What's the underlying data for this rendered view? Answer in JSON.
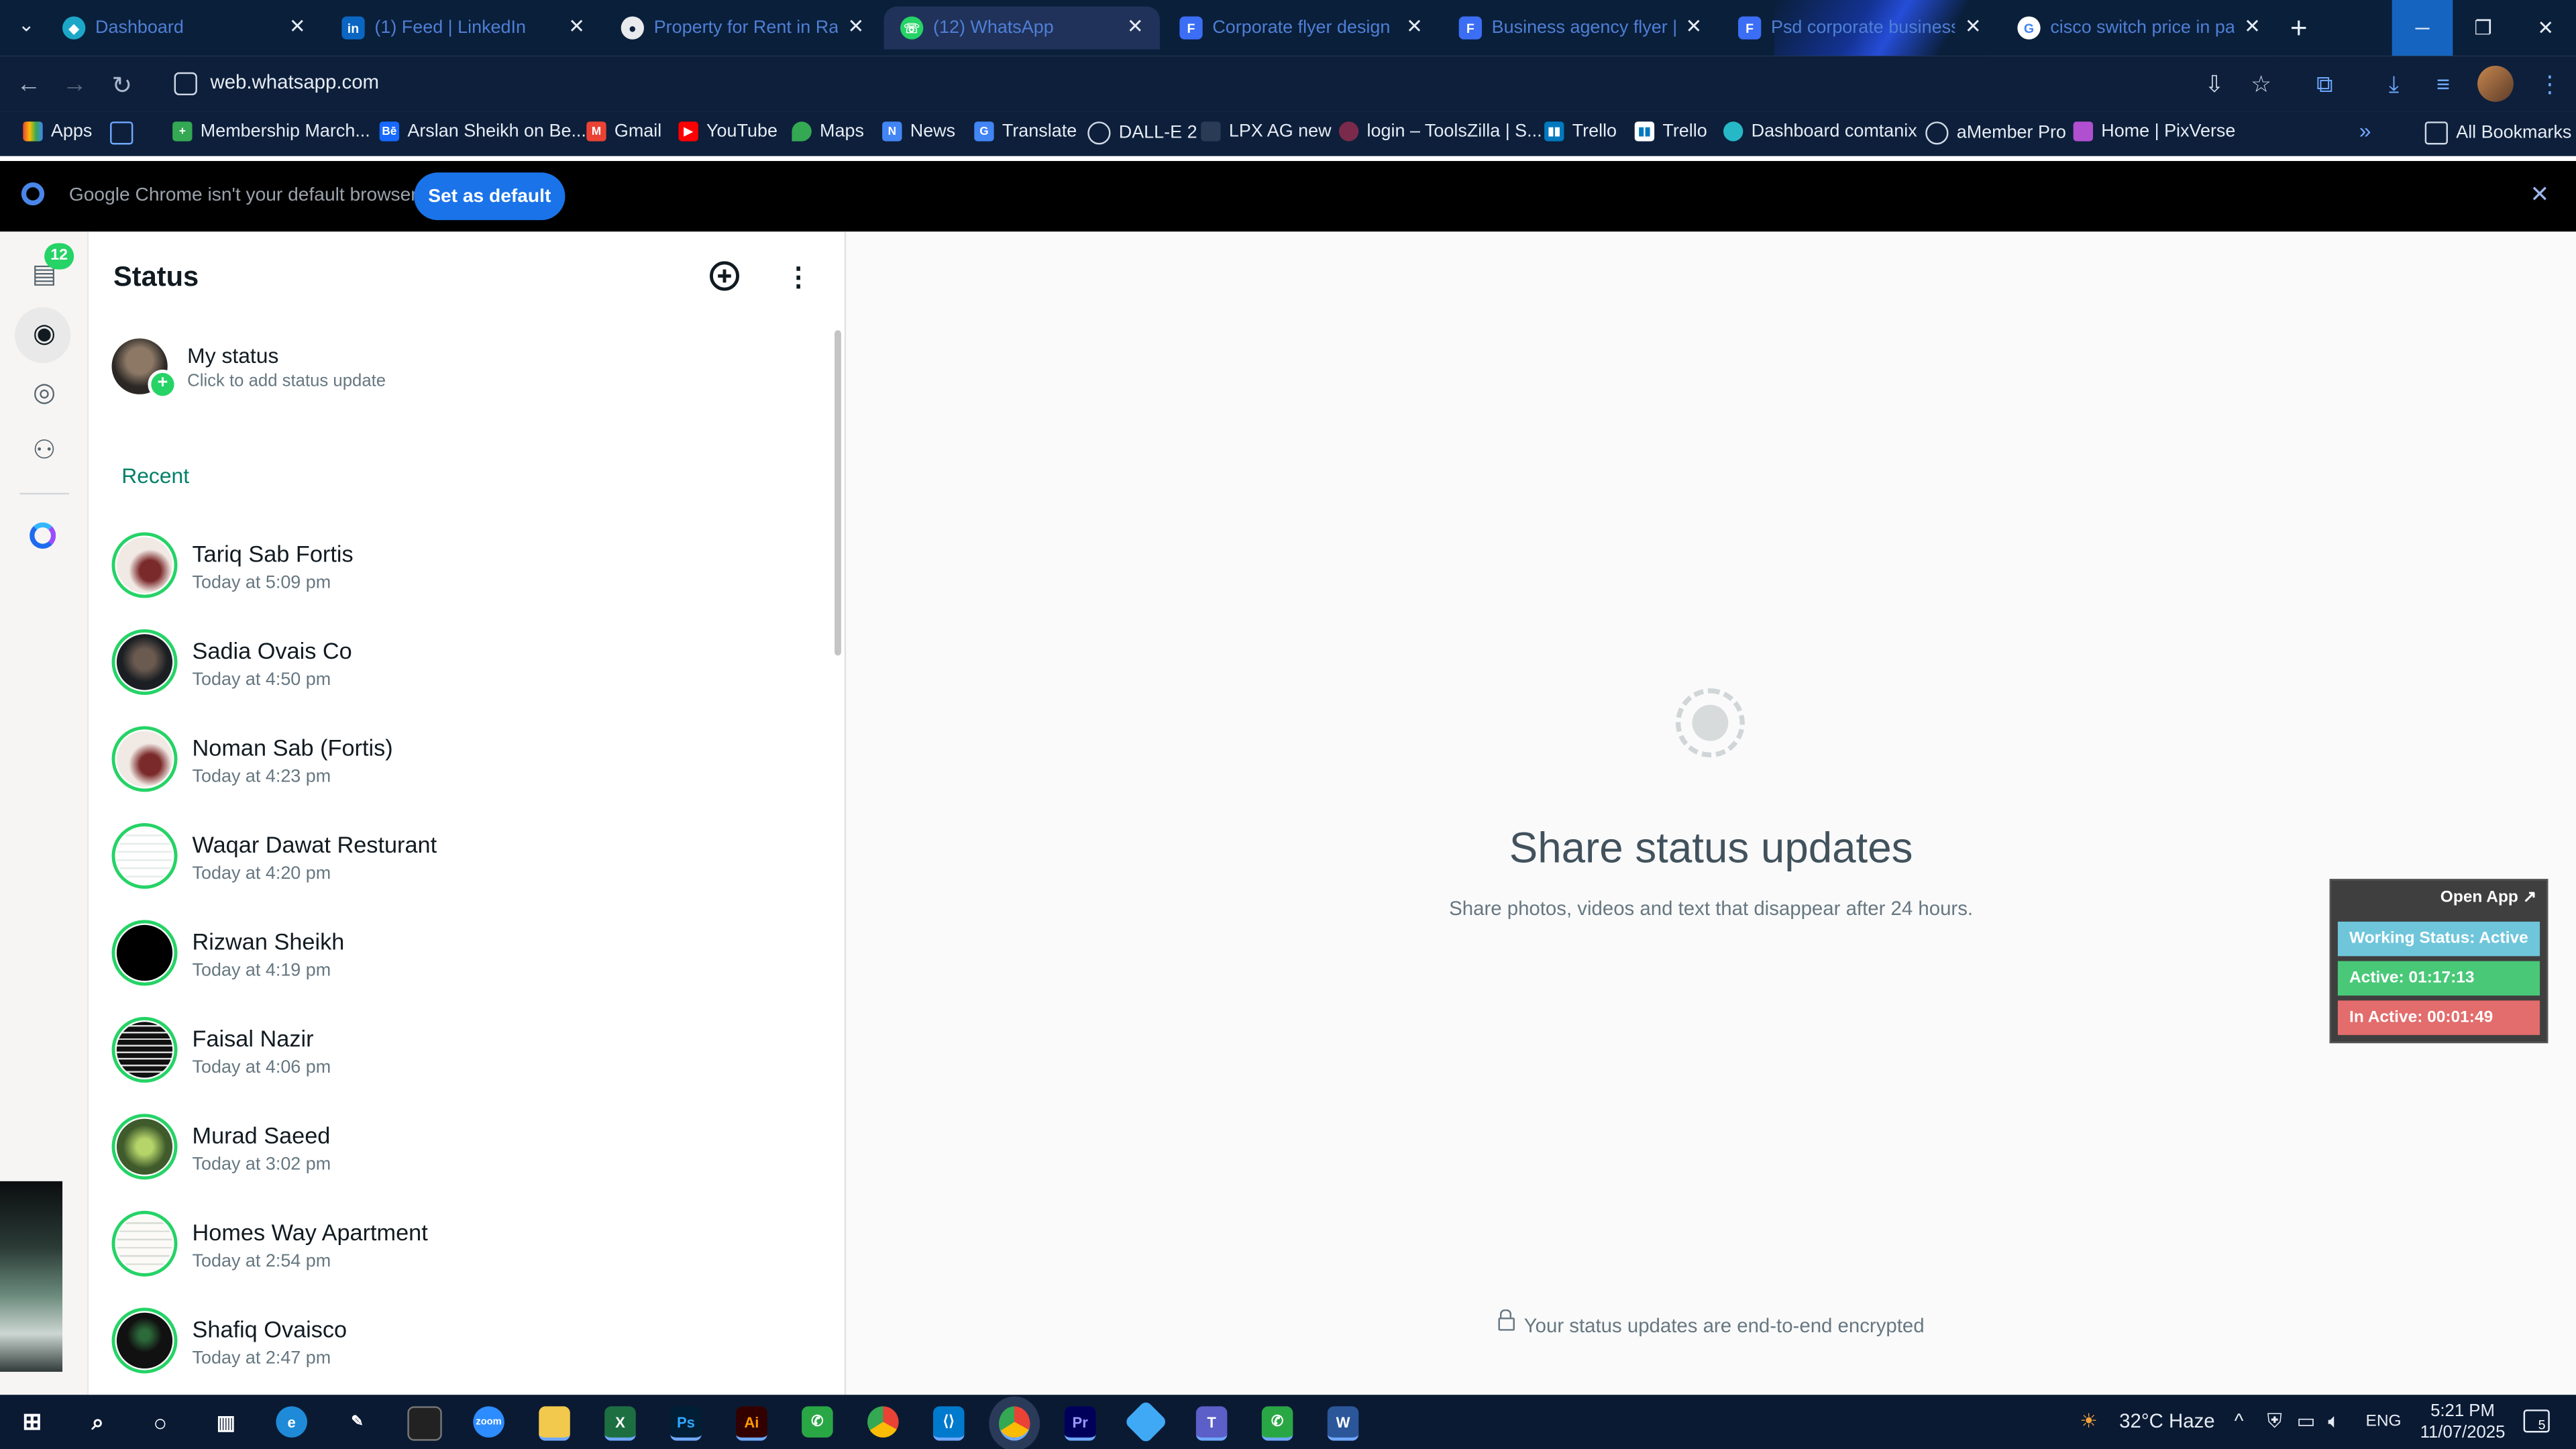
{
  "tabs": [
    {
      "label": "Dashboard",
      "icon": "dashboard-favicon",
      "color": "#1ca7c9"
    },
    {
      "label": "(1) Feed | LinkedIn",
      "icon": "linkedin-favicon",
      "color": "#0a66c2"
    },
    {
      "label": "Property for Rent in Rawal",
      "icon": "property-favicon",
      "color": "#e8eaed"
    },
    {
      "label": "(12) WhatsApp",
      "icon": "whatsapp-favicon",
      "color": "#25d366"
    },
    {
      "label": "Corporate flyer design | P",
      "icon": "freepik-favicon",
      "color": "#3b6ef5"
    },
    {
      "label": "Business agency flyer | Pr",
      "icon": "freepik-favicon",
      "color": "#3b6ef5"
    },
    {
      "label": "Psd corporate business fl",
      "icon": "freepik-favicon",
      "color": "#3b6ef5"
    },
    {
      "label": "cisco switch price in paki",
      "icon": "google-favicon",
      "color": "#ffffff"
    }
  ],
  "address": {
    "url": "web.whatsapp.com"
  },
  "bookmarks": [
    {
      "label": "Apps",
      "icon": "apps-icon"
    },
    {
      "label": "",
      "icon": "grid-icon"
    },
    {
      "label": "Membership March...",
      "icon": "membership-favicon"
    },
    {
      "label": "Arslan Sheikh on Be...",
      "icon": "behance-favicon"
    },
    {
      "label": "Gmail",
      "icon": "gmail-favicon"
    },
    {
      "label": "YouTube",
      "icon": "youtube-favicon"
    },
    {
      "label": "Maps",
      "icon": "maps-favicon"
    },
    {
      "label": "News",
      "icon": "news-favicon"
    },
    {
      "label": "Translate",
      "icon": "translate-favicon"
    },
    {
      "label": "DALL-E 2",
      "icon": "openai-favicon"
    },
    {
      "label": "LPX AG new",
      "icon": "lpx-favicon"
    },
    {
      "label": "login – ToolsZilla | S...",
      "icon": "toolszilla-favicon"
    },
    {
      "label": "Trello",
      "icon": "trello-favicon"
    },
    {
      "label": "Trello",
      "icon": "trello-favicon"
    },
    {
      "label": "Dashboard comtanix",
      "icon": "comtanix-favicon"
    },
    {
      "label": "aMember Pro",
      "icon": "amember-favicon"
    },
    {
      "label": "Home | PixVerse",
      "icon": "pixverse-favicon"
    }
  ],
  "bookmarks_more": "»",
  "all_bookmarks": "All Bookmarks",
  "infobar": {
    "message": "Google Chrome isn't your default browser",
    "button": "Set as default"
  },
  "wa_nav": {
    "chats_badge": "12"
  },
  "status_panel": {
    "title": "Status",
    "my_status_title": "My status",
    "my_status_sub": "Click to add status update",
    "recent_label": "Recent",
    "items": [
      {
        "name": "Tariq Sab Fortis",
        "time": "Today at 5:09 pm"
      },
      {
        "name": "Sadia Ovais Co",
        "time": "Today at 4:50 pm"
      },
      {
        "name": "Noman Sab (Fortis)",
        "time": "Today at 4:23 pm"
      },
      {
        "name": "Waqar Dawat Resturant",
        "time": "Today at 4:20 pm"
      },
      {
        "name": "Rizwan Sheikh",
        "time": "Today at 4:19 pm"
      },
      {
        "name": "Faisal Nazir",
        "time": "Today at 4:06 pm"
      },
      {
        "name": "Murad Saeed",
        "time": "Today at 3:02 pm"
      },
      {
        "name": "Homes Way Apartment",
        "time": "Today at 2:54 pm"
      },
      {
        "name": "Shafiq Ovaisco",
        "time": "Today at 2:47 pm"
      }
    ]
  },
  "right_pane": {
    "title": "Share status updates",
    "subtitle": "Share photos, videos and text that disappear after 24 hours.",
    "encrypted": "Your status updates are end-to-end encrypted"
  },
  "widget": {
    "open_app": "Open App ↗",
    "working_status": "Working Status: Active",
    "active": "Active: 01:17:13",
    "inactive": "In Active: 00:01:49"
  },
  "taskbar": {
    "weather": "32°C  Haze",
    "language": "ENG",
    "time": "5:21 PM",
    "date": "11/07/2025",
    "notifications": "5"
  },
  "colors": {
    "accent_green": "#25d366",
    "brand_dark_green": "#008069",
    "chrome_blue": "#1a73e8"
  }
}
